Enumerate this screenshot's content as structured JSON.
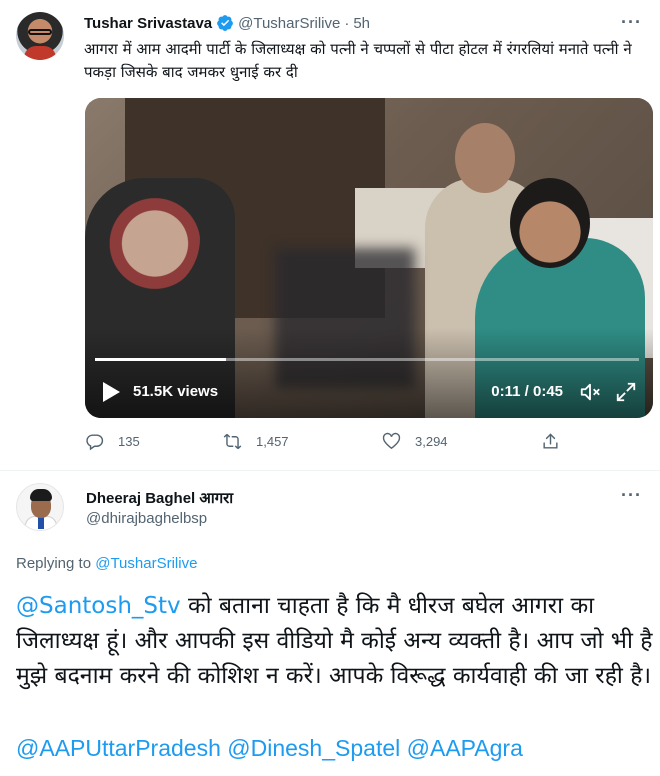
{
  "original_tweet": {
    "author_name": "Tushar Srivastava",
    "handle": "@TusharSrilive",
    "separator": "·",
    "time": "5h",
    "text": "आगरा में आम आदमी पार्टी के जिलाध्यक्ष को पत्नी ने चप्पलों से पीटा होटल में रंगरलियां मनाते पत्नी ने पकड़ा जिसके बाद जमकर धुनाई कर दी",
    "video": {
      "views": "51.5K views",
      "time": "0:11 / 0:45",
      "progress": 0.24
    },
    "actions": {
      "replies": "135",
      "retweets": "1,457",
      "likes": "3,294"
    }
  },
  "reply_tweet": {
    "author_name": "Dheeraj Baghel आगरा",
    "handle": "@dhirajbaghelbsp",
    "replying_prefix": "Replying to",
    "replying_to": "@TusharSrilive",
    "mention": "@Santosh_Stv",
    "text": " को बताना चाहता है कि मै    धीरज बघेल आगरा का जिलाध्यक्ष हूं। और आपकी इस वीडियो मै कोई अन्य व्यक्ती है। आप जो भी है मुझे बदनाम करने की कोशिश न करें। आपके विरूद्ध कार्यवाही की जा रही है।",
    "tags": [
      "@AAPUttarPradesh",
      "@Dinesh_Spatel",
      "@AAPAgra"
    ]
  },
  "icons": {
    "verified": "verified-badge-icon",
    "more": "more-options-icon",
    "reply": "reply-icon",
    "retweet": "retweet-icon",
    "like": "like-icon",
    "share": "share-icon",
    "play": "play-icon",
    "mute": "mute-icon",
    "fullscreen": "fullscreen-icon"
  },
  "colors": {
    "accent": "#1d9bf0",
    "secondary_text": "#536471",
    "primary_text": "#0f1419"
  }
}
